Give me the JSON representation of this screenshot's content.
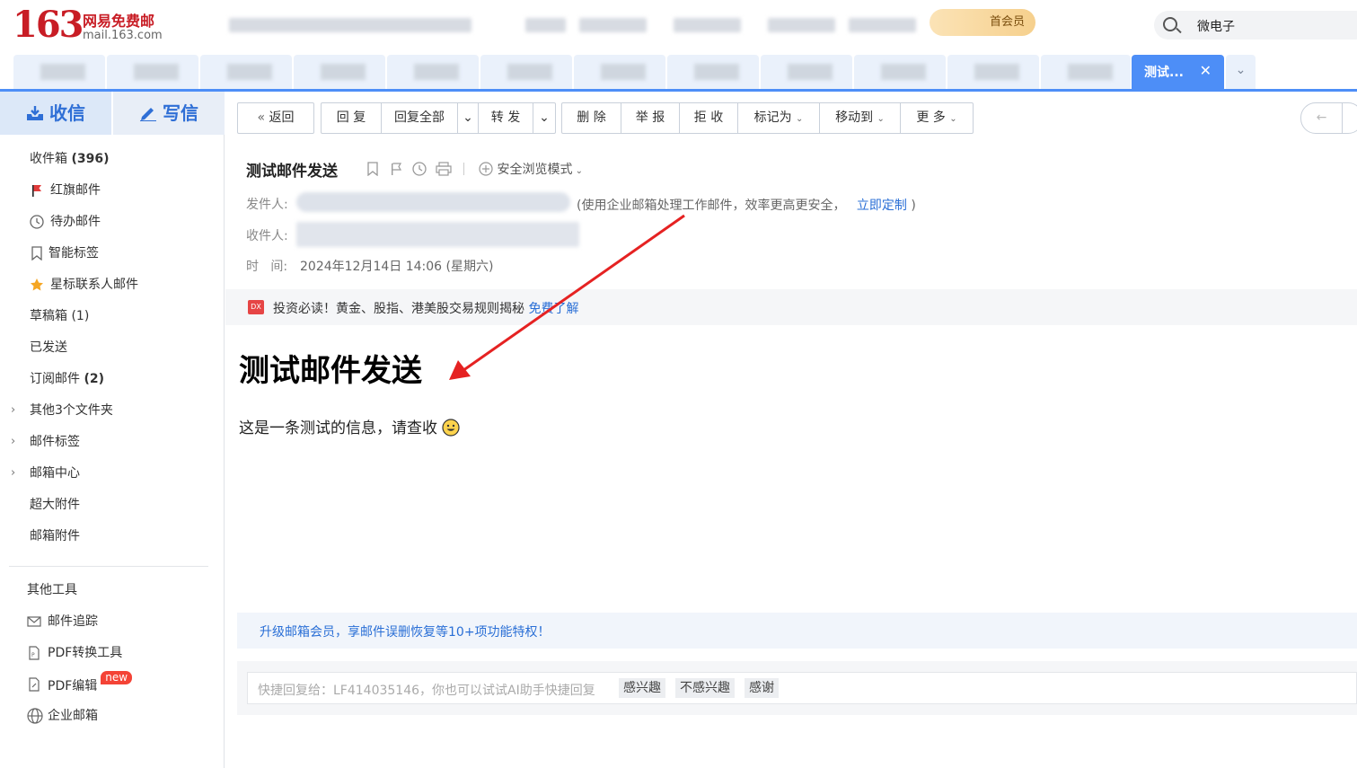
{
  "header": {
    "logo_number": "163",
    "logo_brand": "网易免费邮",
    "logo_domain": "mail.163.com",
    "vip_label": "首会员",
    "search_value": "微电子"
  },
  "tabs": {
    "active_label": "测试...",
    "close_glyph": "✕",
    "more_glyph": "⌄"
  },
  "sidebar": {
    "receive_label": "收信",
    "write_label": "写信",
    "folders": [
      {
        "label": "收件箱",
        "count": "(396)"
      },
      {
        "label": "红旗邮件"
      },
      {
        "label": "待办邮件"
      },
      {
        "label": "智能标签"
      },
      {
        "label": "星标联系人邮件"
      },
      {
        "label": "草稿箱",
        "count": "(1)"
      },
      {
        "label": "已发送"
      },
      {
        "label": "订阅邮件",
        "count": "(2)"
      },
      {
        "label": "其他3个文件夹"
      },
      {
        "label": "邮件标签"
      },
      {
        "label": "邮箱中心"
      },
      {
        "label": "超大附件"
      },
      {
        "label": "邮箱附件"
      }
    ],
    "tools_title": "其他工具",
    "tools": [
      {
        "label": "邮件追踪"
      },
      {
        "label": "PDF转换工具"
      },
      {
        "label": "PDF编辑",
        "badge": "new"
      },
      {
        "label": "企业邮箱"
      }
    ]
  },
  "toolbar": {
    "back": "返回",
    "reply": "回 复",
    "reply_all": "回复全部",
    "forward": "转 发",
    "delete": "删 除",
    "report": "举 报",
    "reject": "拒 收",
    "mark_as": "标记为",
    "move_to": "移动到",
    "more": "更 多"
  },
  "email": {
    "subject": "测试邮件发送",
    "safe_mode": "安全浏览模式",
    "sender_label": "发件人:",
    "sender_note": "(使用企业邮箱处理工作邮件，效率更高更安全，",
    "sender_link": "立即定制",
    "sender_note_end": ")",
    "recipient_label": "收件人:",
    "time_label": "时   间:",
    "time_value": "2024年12月14日 14:06 (星期六)",
    "ad_icon": "DX",
    "ad_text": "投资必读！黄金、股指、港美股交易规则揭秘",
    "ad_link": "免费了解",
    "body_heading": "测试邮件发送",
    "body_text": "这是一条测试的信息，请查收",
    "promo_text": "升级邮箱会员，享邮件误删恢复等10+项功能特权！",
    "quick_reply_prompt": "快捷回复给：LF414035146，你也可以试试AI助手快捷回复",
    "quick_chips": [
      "感兴趣",
      "不感兴趣",
      "感谢"
    ]
  }
}
